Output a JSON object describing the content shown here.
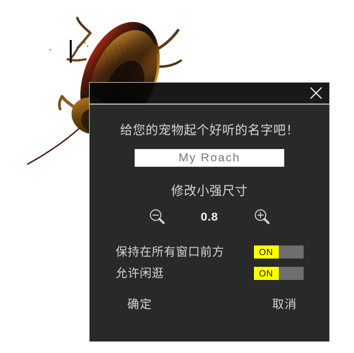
{
  "window": {
    "close_icon": "close-x-icon"
  },
  "dialog": {
    "name_prompt": "给您的宠物起个好听的名字吧！",
    "name_value": "My Roach",
    "name_placeholder": "My Roach",
    "size_label": "修改小强尺寸",
    "size_value": "0.8",
    "zoom_out_icon": "magnifier-minus-icon",
    "zoom_in_icon": "magnifier-plus-icon",
    "toggles": [
      {
        "label": "保持在所有窗口前方",
        "state": "ON"
      },
      {
        "label": "允许闲逛",
        "state": "ON"
      }
    ],
    "confirm_label": "确定",
    "cancel_label": "取消"
  },
  "desktop": {
    "sprite_name": "cockroach-sprite"
  },
  "colors": {
    "titlebar": "#080808",
    "dialog_body": "#292929",
    "border": "#b4b4b4",
    "text": "#d6d6d6",
    "toggle_on": "#ffff00",
    "toggle_track": "#6e6e6e",
    "input_bg": "#ffffff",
    "input_text": "#777777"
  }
}
